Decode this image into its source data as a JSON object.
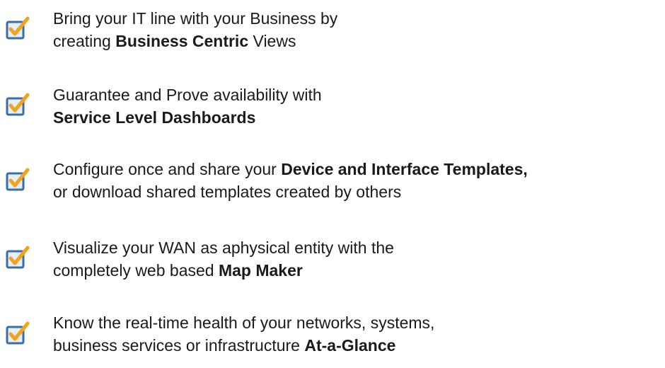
{
  "icons": {
    "checkbox": "checkbox-check-icon",
    "box_border_color": "#3a6ea8",
    "box_fill_color": "#e8eef6",
    "check_color": "#f2a31b"
  },
  "features": [
    {
      "line1": {
        "pre": "Bring your IT line with your Business by",
        "bold": "",
        "post": ""
      },
      "line2": {
        "pre": "creating ",
        "bold": "Business Centric",
        "post": " Views"
      }
    },
    {
      "line1": {
        "pre": "Guarantee and Prove availability with",
        "bold": "",
        "post": ""
      },
      "line2": {
        "pre": "",
        "bold": "Service Level Dashboards",
        "post": ""
      }
    },
    {
      "line1": {
        "pre": "Configure once and share your ",
        "bold": "Device and Interface Templates,",
        "post": ""
      },
      "line2": {
        "pre": "or download shared templates created by others",
        "bold": "",
        "post": ""
      }
    },
    {
      "line1": {
        "pre": "Visualize your WAN as aphysical entity with the",
        "bold": "",
        "post": ""
      },
      "line2": {
        "pre": "completely web based ",
        "bold": "Map Maker",
        "post": ""
      }
    },
    {
      "line1": {
        "pre": "Know the real-time health of your networks, systems,",
        "bold": "",
        "post": ""
      },
      "line2": {
        "pre": "business services or infrastructure ",
        "bold": "At-a-Glance",
        "post": ""
      }
    }
  ]
}
